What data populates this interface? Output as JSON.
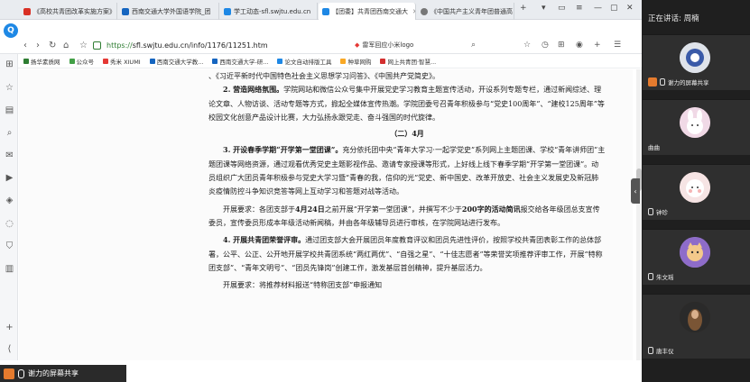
{
  "tabs": [
    {
      "label": "《高校共青团改革实施方案》",
      "color": "#d93025",
      "active": false
    },
    {
      "label": "西南交通大学外国语学院_团",
      "color": "#1565c0",
      "active": false
    },
    {
      "label": "学工动态-sfl.swjtu.edu.cn",
      "color": "#1e88e5",
      "active": false
    },
    {
      "label": "【团委】共青团西南交通大",
      "color": "#1e88e5",
      "active": true
    },
    {
      "label": "《中国共产主义青年团普通高",
      "color": "#777777",
      "active": false
    }
  ],
  "toolbar": {
    "url_https": "https://",
    "url_rest": "sfl.swjtu.edu.cn/info/1176/11251.htm",
    "search_text": "雷军回应小米logo"
  },
  "bookmarks": [
    {
      "label": "扬华素质网",
      "color": "#2e7d32"
    },
    {
      "label": "公众号",
      "color": "#43a047"
    },
    {
      "label": "秀米 XIUMI",
      "color": "#e53935"
    },
    {
      "label": "西南交通大学教...",
      "color": "#1565c0"
    },
    {
      "label": "西南交通大学-研...",
      "color": "#1565c0"
    },
    {
      "label": "论文自动排版工具",
      "color": "#1e88e5"
    },
    {
      "label": "种草网购",
      "color": "#f9a825"
    },
    {
      "label": "网上共青团·智慧...",
      "color": "#d32f2f"
    }
  ],
  "document": {
    "line_top": "、《习近平新时代中国特色社会主义思想学习问答》、《中国共产党简史》。",
    "p2_bold": "2. 营造网络氛围。",
    "p2_text": "学院网站和微信公众号集中开展党史学习教育主题宣传活动，开设系列专题专栏，通过新闻综述、理论文章、人物访谈、活动专题等方式，掀起全媒体宣传热潮。学院团委号召青年积极参与“党史100周年”、“建校125周年”等校园文化创意产品设计比赛，大力弘扬永跟党走、奋斗强国的时代旋律。",
    "sub": "（二）4月",
    "p3_bold": "3. 开设春季学期“开学第一堂团课”。",
    "p3_text": "充分依托团中央“青年大学习·一起学党史”系列网上主题团课、学校“青年讲师团”主题团课等网络资源，通过观看优秀党史主题影视作品、邀请专家授课等形式，上好线上线下春季学期“开学第一堂团课”。动员组织广大团员青年积极参与党史大学习暨“青春的我，信仰的光”党史、新中国史、改革开放史、社会主义发展史及新冠肺炎疫情防控斗争知识竞答等网上互动学习和答题对战等活动。",
    "req_lead": "开展要求：各团支部于",
    "req_bold1": "4月24日",
    "req_mid": "之前开展“开学第一堂团课”，并撰写不少于",
    "req_bold2": "200字的活动简讯",
    "req_tail": "报交给各年级团总支宣传委员，宣传委员形成本年级活动新闻稿，并由各年级辅导员进行审核，在学院网站进行发布。",
    "p4_bold": "4. 开展共青团荣誉评审。",
    "p4_text": "通过团支部大会开展团员年度教育评议和团员先进性评价，按照学校共青团表彰工作的总体部署，公平、公正、公开地开展学校共青团系统“两红两优”、“自强之星”、“十佳志愿者”等荣誉奖项推荐评审工作，开展“特称团支部”、“青年文明号”、“团员先锋岗”创建工作，激发基层首创精神，提升基层活力。",
    "p5_text": "开展要求：将推荐材料报送“特称团支部”申报通知"
  },
  "statusbar": {
    "label": "谢力的屏幕共享"
  },
  "panel": {
    "header": "正在讲话: 周楠",
    "participants": [
      {
        "label": "谢力的屏幕共享",
        "avatar_color": "#dfe3ea",
        "presenting": true
      },
      {
        "label": "曲曲",
        "avatar_color": "#e8c7d9",
        "presenting": false
      },
      {
        "label": "钟珍",
        "avatar_color": "#f2d9d9",
        "presenting": false
      },
      {
        "label": "朱文瑶",
        "avatar_color": "#a58ad6",
        "presenting": false
      },
      {
        "label": "唐丰仪",
        "avatar_color": "#6b4a2e",
        "presenting": false
      }
    ]
  }
}
